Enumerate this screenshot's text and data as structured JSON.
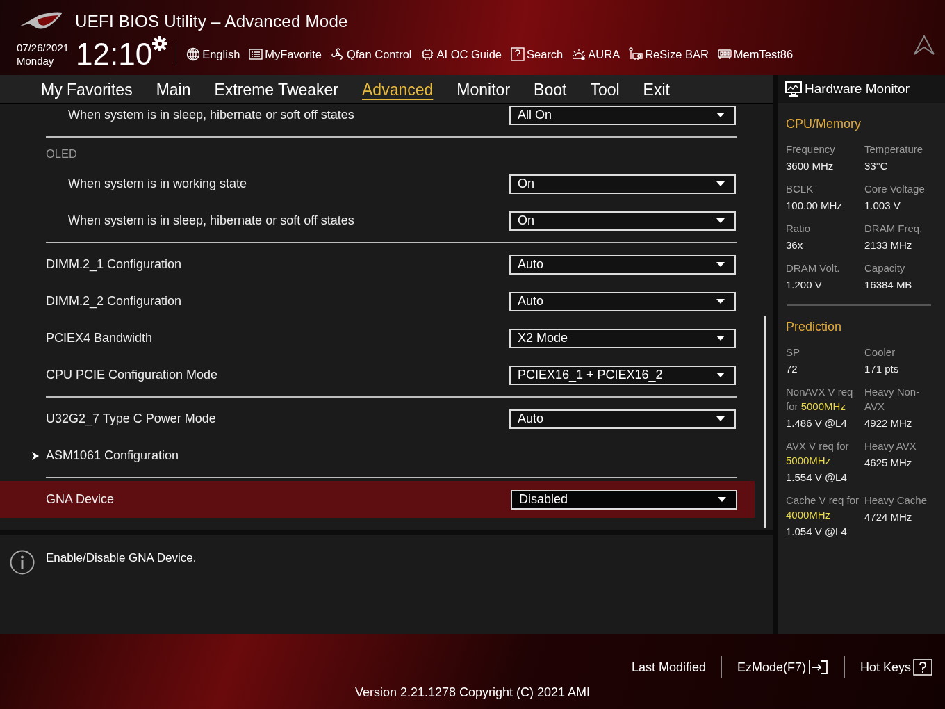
{
  "header": {
    "title": "UEFI BIOS Utility – Advanced Mode",
    "date": "07/26/2021",
    "day": "Monday",
    "time": "12:10"
  },
  "toolbar": [
    {
      "label": "English"
    },
    {
      "label": "MyFavorite"
    },
    {
      "label": "Qfan Control"
    },
    {
      "label": "AI OC Guide"
    },
    {
      "label": "Search"
    },
    {
      "label": "AURA"
    },
    {
      "label": "ReSize BAR"
    },
    {
      "label": "MemTest86"
    }
  ],
  "tabs": [
    {
      "label": "My Favorites",
      "selected": false
    },
    {
      "label": "Main",
      "selected": false
    },
    {
      "label": "Extreme Tweaker",
      "selected": false
    },
    {
      "label": "Advanced",
      "selected": true
    },
    {
      "label": "Monitor",
      "selected": false
    },
    {
      "label": "Boot",
      "selected": false
    },
    {
      "label": "Tool",
      "selected": false
    },
    {
      "label": "Exit",
      "selected": false
    }
  ],
  "settings": [
    {
      "kind": "group",
      "children": [
        {
          "kind": "setting",
          "label": "When system is in sleep, hibernate or soft off states",
          "value": "All On",
          "selected": false
        }
      ]
    },
    {
      "kind": "divider"
    },
    {
      "kind": "group",
      "label": "OLED",
      "children": [
        {
          "kind": "setting",
          "label": "When system is in working state",
          "value": "On",
          "selected": false
        },
        {
          "kind": "setting",
          "label": "When system is in sleep, hibernate or soft off states",
          "value": "On",
          "selected": false
        }
      ]
    },
    {
      "kind": "divider"
    },
    {
      "kind": "setting",
      "label": "DIMM.2_1 Configuration",
      "value": "Auto",
      "selected": false
    },
    {
      "kind": "setting",
      "label": "DIMM.2_2 Configuration",
      "value": "Auto",
      "selected": false
    },
    {
      "kind": "setting",
      "label": "PCIEX4 Bandwidth",
      "value": "X2 Mode",
      "selected": false
    },
    {
      "kind": "setting",
      "label": "CPU PCIE Configuration Mode",
      "value": "PCIEX16_1 + PCIEX16_2",
      "selected": false
    },
    {
      "kind": "divider"
    },
    {
      "kind": "setting",
      "label": "U32G2_7 Type C Power Mode",
      "value": "Auto",
      "selected": false
    },
    {
      "kind": "submenu",
      "label": "ASM1061 Configuration",
      "selected": false
    },
    {
      "kind": "divider"
    },
    {
      "kind": "setting",
      "label": "GNA Device",
      "value": "Disabled",
      "selected": true
    }
  ],
  "help": "Enable/Disable GNA Device.",
  "hardware_monitor": {
    "title": "Hardware Monitor",
    "sections": [
      {
        "title": "CPU/Memory",
        "cells": [
          {
            "label": "Frequency",
            "value": "3600 MHz"
          },
          {
            "label": "Temperature",
            "value": "33°C"
          },
          {
            "label": "BCLK",
            "value": "100.00 MHz"
          },
          {
            "label": "Core Voltage",
            "value": "1.003 V"
          },
          {
            "label": "Ratio",
            "value": "36x"
          },
          {
            "label": "DRAM Freq.",
            "value": "2133 MHz"
          },
          {
            "label": "DRAM Volt.",
            "value": "1.200 V"
          },
          {
            "label": "Capacity",
            "value": "16384 MB"
          }
        ]
      },
      {
        "title": "Prediction",
        "cells": [
          {
            "label": "SP",
            "value": "72"
          },
          {
            "label": "Cooler",
            "value": "171 pts"
          },
          {
            "label": "NonAVX V req for",
            "highlight": "5000MHz",
            "value": "1.486 V @L4"
          },
          {
            "label": "Heavy Non-AVX",
            "value": "4922 MHz"
          },
          {
            "label": "AVX V req for",
            "highlight": "5000MHz",
            "value": "1.554 V @L4"
          },
          {
            "label": "Heavy AVX",
            "value": "4625 MHz"
          },
          {
            "label": "Cache V req for",
            "highlight": "4000MHz",
            "value": "1.054 V @L4"
          },
          {
            "label": "Heavy Cache",
            "value": "4724 MHz"
          }
        ]
      }
    ]
  },
  "footer": {
    "actions": [
      "Last Modified",
      "EzMode(F7)",
      "Hot Keys"
    ],
    "version": "Version 2.21.1278 Copyright (C) 2021 AMI"
  }
}
